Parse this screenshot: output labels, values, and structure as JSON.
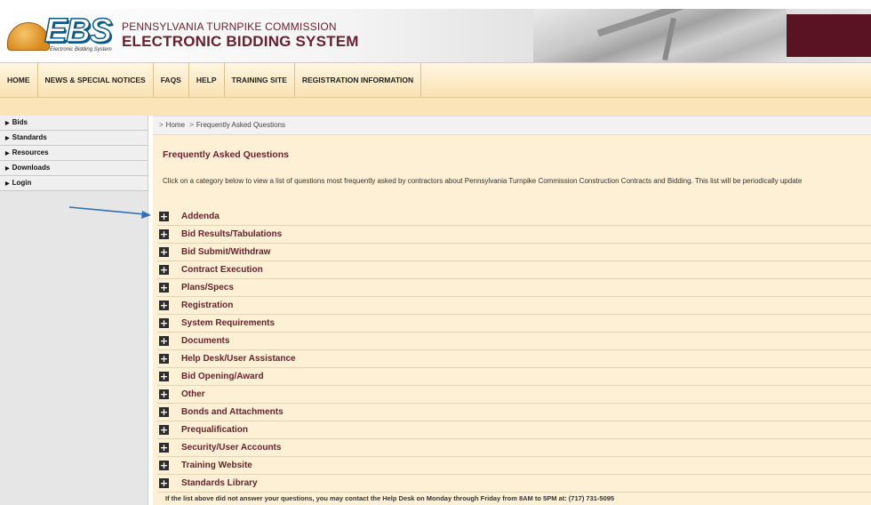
{
  "header": {
    "logo_text": "EBS",
    "logo_tagline": "Electronic Bidding System",
    "org_line1": "PENNSYLVANIA TURNPIKE COMMISSION",
    "org_line2": "ELECTRONIC BIDDING SYSTEM"
  },
  "nav": {
    "items": [
      "HOME",
      "NEWS & SPECIAL NOTICES",
      "FAQS",
      "HELP",
      "TRAINING SITE",
      "REGISTRATION INFORMATION"
    ]
  },
  "sidebar": {
    "items": [
      "Bids",
      "Standards",
      "Resources",
      "Downloads",
      "Login"
    ]
  },
  "breadcrumb": {
    "home": "Home",
    "current": "Frequently Asked Questions"
  },
  "main": {
    "title": "Frequently Asked Questions",
    "intro": "Click on a category below to view a list of questions most frequently asked by contractors about Pennsylvania Turnpike Commission Construction Contracts and Bidding. This list will be periodically update",
    "categories": [
      "Addenda",
      "Bid Results/Tabulations",
      "Bid Submit/Withdraw",
      "Contract Execution",
      "Plans/Specs",
      "Registration",
      "System Requirements",
      "Documents",
      "Help Desk/User Assistance",
      "Bid Opening/Award",
      "Other",
      "Bonds and Attachments",
      "Prequalification",
      "Security/User Accounts",
      "Training Website",
      "Standards Library"
    ],
    "expand_glyph": "+",
    "footer_note": "If the list above did not answer your questions, you may contact the Help Desk on Monday through Friday from 8AM to 5PM at: (717) 731-5095"
  },
  "colors": {
    "maroon": "#6a1f2e",
    "content_bg": "#fdf0d5",
    "annotation_arrow": "#2f6fb3"
  }
}
